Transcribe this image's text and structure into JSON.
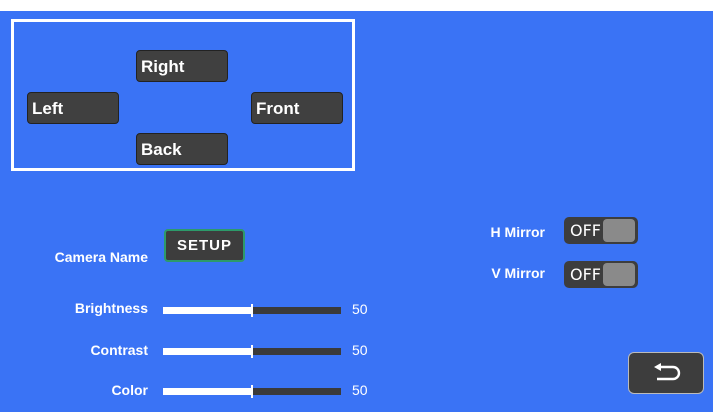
{
  "positions": {
    "right": "Right",
    "left": "Left",
    "front": "Front",
    "back": "Back"
  },
  "camera": {
    "name_label": "Camera Name",
    "setup_label": "SETUP"
  },
  "adjustments": [
    {
      "label": "Brightness",
      "value": 50,
      "value_text": "50"
    },
    {
      "label": "Contrast",
      "value": 50,
      "value_text": "50"
    },
    {
      "label": "Color",
      "value": 50,
      "value_text": "50"
    }
  ],
  "slider_max": 100,
  "mirror": {
    "h_label": "H Mirror",
    "h_state": "OFF",
    "v_label": "V Mirror",
    "v_state": "OFF"
  },
  "back_icon": "return-arrow-icon",
  "colors": {
    "background": "#3a73f5",
    "button": "#404040",
    "setup_border": "#2d9a6a"
  }
}
